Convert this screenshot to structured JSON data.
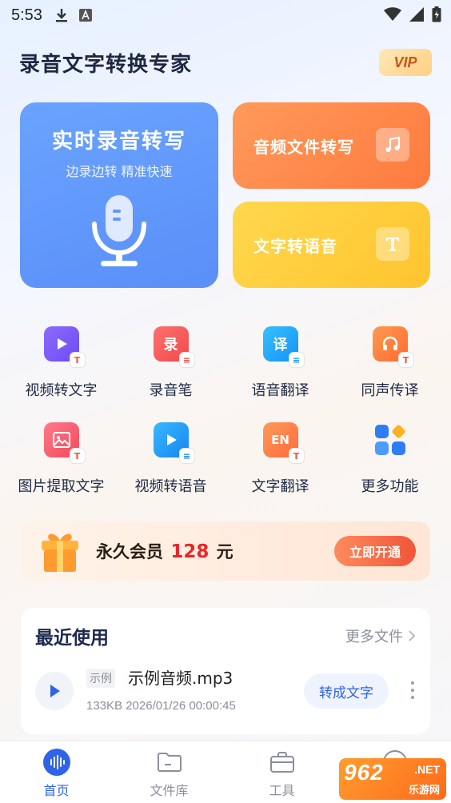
{
  "status_bar": {
    "time": "5:53"
  },
  "header": {
    "title": "录音文字转换专家",
    "vip_label": "VIP"
  },
  "cards": {
    "realtime": {
      "title": "实时录音转写",
      "subtitle": "边录边转 精准快速"
    },
    "audio_file": {
      "label": "音频文件转写",
      "icon": "music-note-icon"
    },
    "text_to_speech": {
      "label": "文字转语音",
      "icon": "text-t-icon"
    }
  },
  "features": [
    {
      "label": "视频转文字",
      "icon": "video-to-text-icon",
      "color": "#7b5cff"
    },
    {
      "label": "录音笔",
      "icon": "recorder-pen-icon",
      "color": "#ff5a5a",
      "glyph": "录"
    },
    {
      "label": "语音翻译",
      "icon": "voice-translate-icon",
      "color": "#1fb0ff",
      "glyph": "译"
    },
    {
      "label": "同声传译",
      "icon": "headset-icon",
      "color": "#ff7a3e"
    },
    {
      "label": "图片提取文字",
      "icon": "image-text-icon",
      "color": "#ff5a6a"
    },
    {
      "label": "视频转语音",
      "icon": "video-to-voice-icon",
      "color": "#1fa6ff"
    },
    {
      "label": "文字翻译",
      "icon": "text-translate-icon",
      "color": "#ff8040",
      "glyph": "EN"
    },
    {
      "label": "更多功能",
      "icon": "more-apps-icon",
      "color": "#3a8cff"
    }
  ],
  "banner": {
    "prefix": "永久会员",
    "price": "128",
    "suffix": "元",
    "button_label": "立即开通"
  },
  "recent": {
    "title": "最近使用",
    "more_label": "更多文件",
    "item": {
      "tag": "示例",
      "file_name": "示例音频.mp3",
      "meta": "133KB 2026/01/26 00:00:45",
      "convert_label": "转成文字"
    }
  },
  "tabs": [
    {
      "label": "首页",
      "active": true
    },
    {
      "label": "文件库",
      "active": false
    },
    {
      "label": "工具",
      "active": false
    },
    {
      "label": "",
      "active": false
    }
  ],
  "watermark": {
    "text": "962",
    "suffix": ".NET",
    "cn": "乐游网"
  },
  "colors": {
    "accent": "#2f63e8",
    "price": "#e8262a"
  }
}
